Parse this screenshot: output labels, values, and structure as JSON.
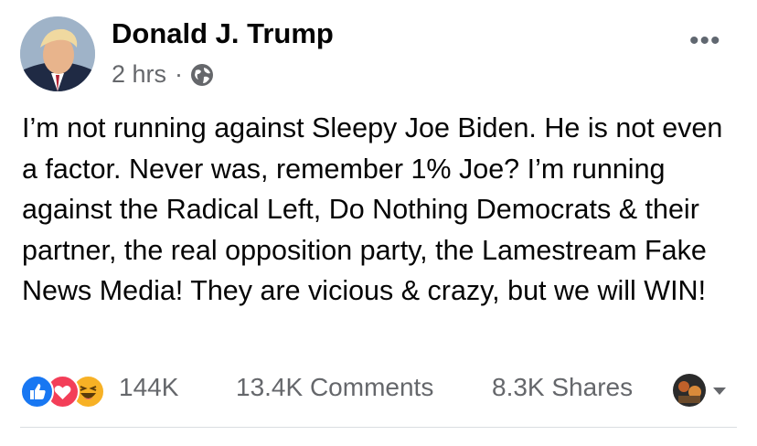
{
  "post": {
    "author": "Donald J. Trump",
    "timestamp": "2 hrs",
    "separator": "·",
    "audience_icon": "globe-icon",
    "menu_icon": "more-options-icon",
    "menu_glyph": "•••",
    "text": "I’m not running against Sleepy Joe Biden. He is not even a factor. Never was, remember 1% Joe? I’m running against the Radical Left, Do Nothing Democrats & their partner, the real opposition party, the Lamestream Fake News Media! They are vicious & crazy, but we will WIN!"
  },
  "stats": {
    "reaction_icons": [
      "like-icon",
      "love-icon",
      "haha-icon"
    ],
    "reaction_count": "144K",
    "comments": "13.4K Comments",
    "shares": "8.3K Shares"
  },
  "colors": {
    "text": "#050505",
    "secondary_text": "#65676b",
    "like_blue": "#1877f2",
    "love_red": "#f33e58",
    "haha_yellow": "#f7b125",
    "divider": "#dadde1"
  }
}
